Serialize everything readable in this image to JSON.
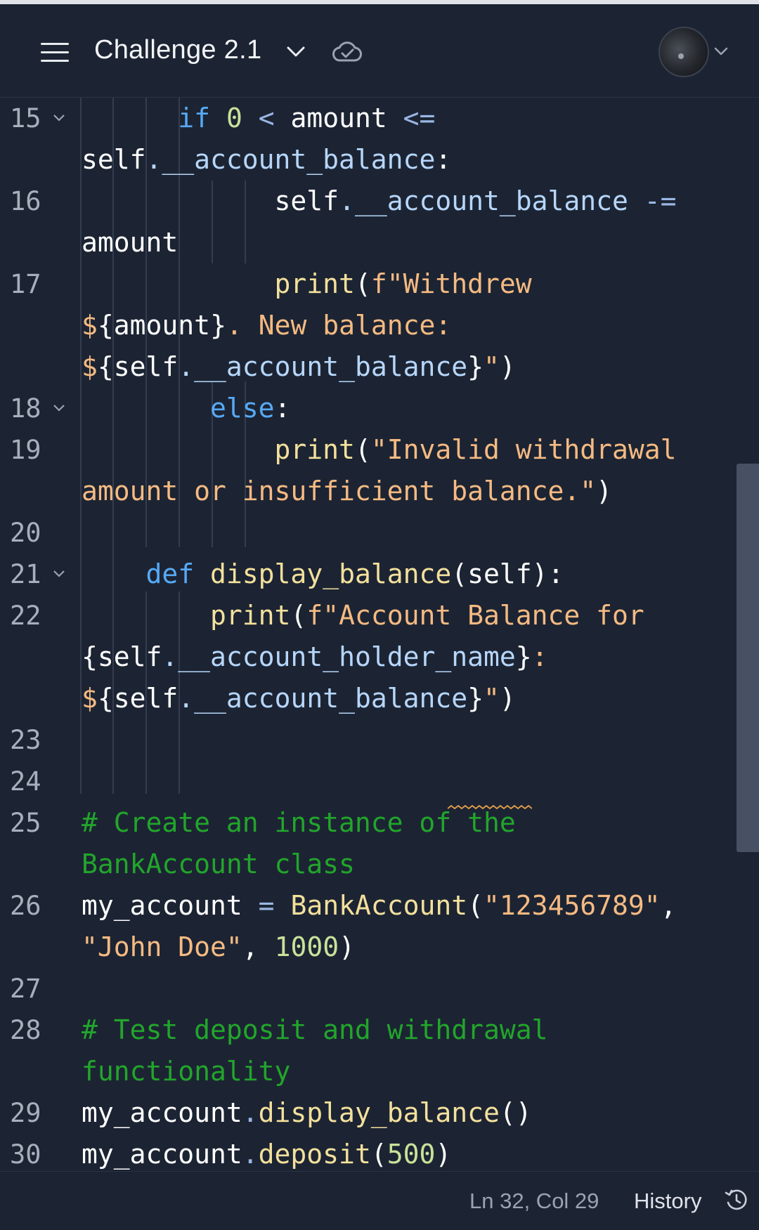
{
  "header": {
    "title": "Challenge 2.1",
    "menu_icon": "hamburger-menu-icon",
    "chevron_icon": "chevron-down-icon",
    "status_icon": "cloud-check-icon",
    "avatar_icon": "user-avatar"
  },
  "editor": {
    "line_numbers": [
      "15",
      "16",
      "17",
      "18",
      "19",
      "20",
      "21",
      "22",
      "23",
      "24",
      "25",
      "26",
      "27",
      "28",
      "29",
      "30"
    ],
    "colors": {
      "keyword": "#57aaf6",
      "number": "#c8e29a",
      "function": "#f3e09c",
      "string": "#f5ba82",
      "attribute": "#b6d6fa",
      "comment": "#22a52b",
      "background": "#1c2433"
    },
    "code": {
      "l15": {
        "kw": "if",
        "num": "0",
        "op": "<",
        "var": "amount",
        "op2": "<="
      },
      "l15b": {
        "self": "self",
        "attr": ".__account_balance",
        "colon": ":"
      },
      "l16": {
        "self": "self",
        "attr": ".__account_balance",
        "op": "-="
      },
      "l16b": {
        "var": "amount"
      },
      "l17": {
        "fn": "print",
        "paren": "(",
        "str": "f\"Withdrew"
      },
      "l17b": {
        "dollar": "$",
        "brace_open": "{",
        "var": "amount",
        "brace_close": "}",
        "str": ". New balance:"
      },
      "l17c": {
        "dollar": "$",
        "brace_open": "{",
        "self": "self",
        "attr": ".__account_balance",
        "brace_close": "}",
        "str": "\"",
        "paren": ")"
      },
      "l18": {
        "kw": "else",
        "colon": ":"
      },
      "l19": {
        "fn": "print",
        "paren": "(",
        "str": "\"Invalid withdrawal"
      },
      "l19b": {
        "str": "amount or insufficient balance.\"",
        "paren": ")"
      },
      "l21": {
        "kw": "def",
        "fn": "display_balance",
        "params": "(self):"
      },
      "l22": {
        "fn": "print",
        "paren": "(",
        "str": "f\"Account Balance for"
      },
      "l22b": {
        "brace_open": "{",
        "self": "self",
        "attr": ".__account_holder_name",
        "brace_close": "}",
        "str": ":"
      },
      "l22c": {
        "dollar": "$",
        "brace_open": "{",
        "self": "self",
        "attr": ".__account_balance",
        "brace_close": "}",
        "str": "\"",
        "paren": ")"
      },
      "l25": {
        "cmt": "# Create an instance of the"
      },
      "l25b": {
        "cmt": "BankAccount class"
      },
      "l26": {
        "var": "my_account",
        "op": "=",
        "fn": "BankAccount",
        "paren": "(",
        "str": "\"123456789\"",
        "comma": ","
      },
      "l26b": {
        "str": "\"John Doe\"",
        "comma": ",",
        "num": "1000",
        "paren": ")"
      },
      "l28": {
        "cmt": "# Test deposit and withdrawal"
      },
      "l28b": {
        "cmt": "functionality"
      },
      "l29": {
        "var": "my_account",
        "dot": ".",
        "fn": "display_balance",
        "paren": "()"
      },
      "l30": {
        "var": "my_account",
        "dot": ".",
        "fn": "deposit",
        "paren": "(",
        "num": "500",
        "paren2": ")"
      }
    }
  },
  "footer": {
    "cursor_position": "Ln 32, Col 29",
    "history_label": "History",
    "history_icon": "history-clock-icon"
  }
}
